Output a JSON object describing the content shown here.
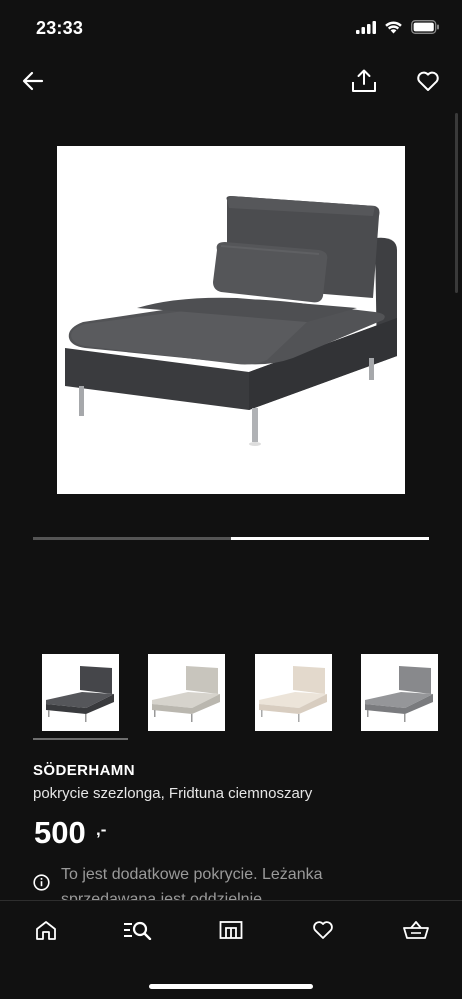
{
  "status_bar": {
    "time": "23:33",
    "icons": [
      "signal-icon",
      "wifi-icon",
      "battery-icon"
    ]
  },
  "nav": {
    "icons": [
      "back-arrow-icon",
      "share-icon",
      "heart-icon"
    ]
  },
  "gallery": {
    "current_index": 2,
    "total_images": 2
  },
  "variants": [
    {
      "name": "dark-grey",
      "color": "#4a4b4d",
      "selected": true
    },
    {
      "name": "light-beige",
      "color": "#cfccc5",
      "selected": false
    },
    {
      "name": "cream",
      "color": "#e6ddd2",
      "selected": false
    },
    {
      "name": "medium-grey",
      "color": "#8e8f90",
      "selected": false
    }
  ],
  "product": {
    "name": "SÖDERHAMN",
    "description": "pokrycie szezlonga, Fridtuna ciemnoszary",
    "price": "500",
    "price_suffix": ",-",
    "notice": "To jest dodatkowe pokrycie. Leżanka sprzedawana jest oddzielnie."
  },
  "tab_bar": {
    "tabs": [
      "home-icon",
      "search-list-icon",
      "store-icon",
      "heart-icon",
      "basket-icon"
    ],
    "active_tab": "search-list-icon"
  },
  "colors": {
    "background": "#111111",
    "text": "#ffffff",
    "muted_text": "#9a9a9a"
  }
}
